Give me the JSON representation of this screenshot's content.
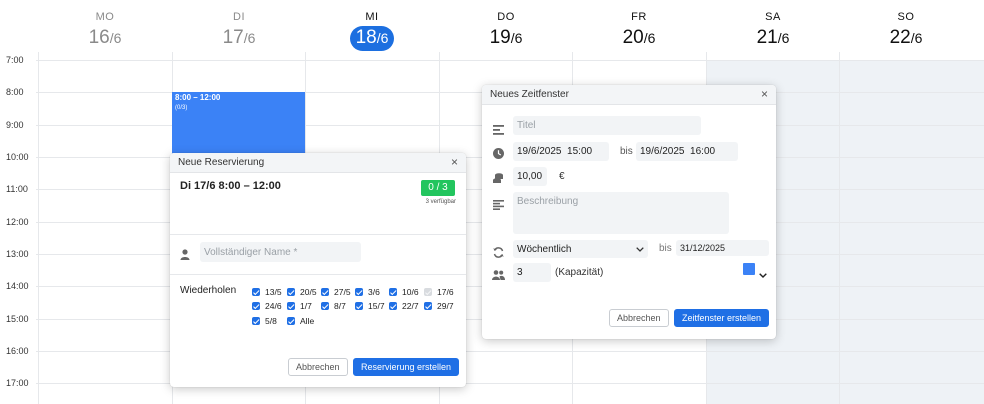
{
  "calendar": {
    "days": [
      {
        "name": "MO",
        "day": "16",
        "month": "/6",
        "state": "past"
      },
      {
        "name": "DI",
        "day": "17",
        "month": "/6",
        "state": "past"
      },
      {
        "name": "MI",
        "day": "18",
        "month": "/6",
        "state": "today"
      },
      {
        "name": "DO",
        "day": "19",
        "month": "/6",
        "state": "future"
      },
      {
        "name": "FR",
        "day": "20",
        "month": "/6",
        "state": "future"
      },
      {
        "name": "SA",
        "day": "21",
        "month": "/6",
        "state": "future"
      },
      {
        "name": "SO",
        "day": "22",
        "month": "/6",
        "state": "future"
      }
    ],
    "hours": [
      "7:00",
      "8:00",
      "9:00",
      "10:00",
      "11:00",
      "12:00",
      "13:00",
      "14:00",
      "15:00",
      "16:00",
      "17:00"
    ],
    "event": {
      "time": "8:00 – 12:00",
      "count": "(0/3)",
      "color": "#3b82f6"
    },
    "today_color": "#1c6fe0",
    "weekend_color": "#eef2f6"
  },
  "reservation_dialog": {
    "title": "Neue Reservierung",
    "close": "×",
    "slot": "Di 17/6  8:00 – 12:00",
    "availability_badge": "0 / 3",
    "availability_text": "3 verfügbar",
    "badge_color": "#22c55e",
    "name_placeholder": "Vollständiger Name *",
    "name_icon": "person-icon",
    "repeat_label": "Wiederholen",
    "repeat_dates": [
      {
        "label": "13/5",
        "checked": true
      },
      {
        "label": "20/5",
        "checked": true
      },
      {
        "label": "27/5",
        "checked": true
      },
      {
        "label": "3/6",
        "checked": true
      },
      {
        "label": "10/6",
        "checked": true
      },
      {
        "label": "17/6",
        "checked": false
      },
      {
        "label": "24/6",
        "checked": true
      },
      {
        "label": "1/7",
        "checked": true
      },
      {
        "label": "8/7",
        "checked": true
      },
      {
        "label": "15/7",
        "checked": true
      },
      {
        "label": "22/7",
        "checked": true
      },
      {
        "label": "29/7",
        "checked": true
      },
      {
        "label": "5/8",
        "checked": true
      },
      {
        "label": "Alle",
        "checked": true
      }
    ],
    "cancel_label": "Abbrechen",
    "submit_label": "Reservierung erstellen"
  },
  "timeslot_dialog": {
    "title": "Neues Zeitfenster",
    "close": "×",
    "title_placeholder": "Titel",
    "start_value": "19/6/2025  15:00",
    "until_label": "bis",
    "end_value": "19/6/2025  16:00",
    "price_value": "10,00",
    "currency": "€",
    "description_placeholder": "Beschreibung",
    "recurrence_value": "Wöchentlich",
    "recurrence_until_label": "bis",
    "recurrence_until_value": "31/12/2025",
    "capacity_value": "3",
    "capacity_label": "(Kapazität)",
    "swatch_color": "#3b82f6",
    "cancel_label": "Abbrechen",
    "submit_label": "Zeitfenster erstellen"
  }
}
